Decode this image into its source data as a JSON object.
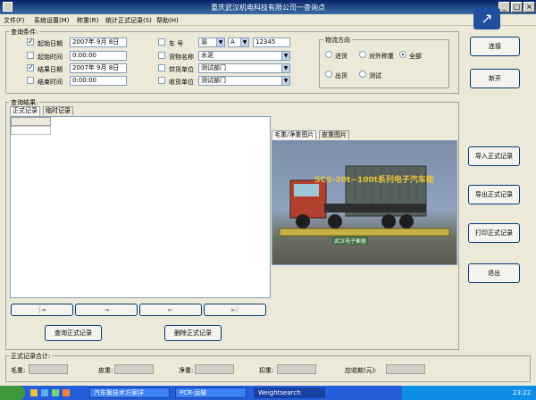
{
  "window": {
    "title": "重庆武汉机电科技有限公司一查询点"
  },
  "menu": [
    "文件(F)",
    "系统设置(M)",
    "称重(R)",
    "统计正式记录(S)",
    "帮助(H)"
  ],
  "query": {
    "group_label": "查询条件:",
    "start_date_label": "起始日期",
    "start_date_value": "2007年 9月 8日",
    "start_time_label": "起始时间",
    "start_time_value": "0:00:00",
    "end_date_label": "结果日期",
    "end_date_value": "2007年 9月 8日",
    "end_time_label": "结束时间",
    "end_time_value": "0:00:00",
    "plate_label": "车  号",
    "plate_province": "渝",
    "plate_letter": "A",
    "plate_number": "12345",
    "goods_label": "货物名称",
    "goods_value": "水泥",
    "supplier_label": "供货单位",
    "supplier_value": "测试部门",
    "receiver_label": "收货单位",
    "receiver_value": "测试部门"
  },
  "direction": {
    "label": "物流方向",
    "in": "进货",
    "external": "对外称重",
    "all": "全部",
    "out": "出货",
    "test": "测试"
  },
  "buttons": {
    "connect": "连接",
    "new": "新开",
    "import": "导入正式记录",
    "export": "导出正式记录",
    "print": "打印正式记录",
    "exit": "退出",
    "query_formal": "查询正式记录",
    "delete_formal": "删除正式记录"
  },
  "results": {
    "group_label": "查询结果:",
    "tab_formal": "正式记录",
    "tab_temp": "临时记录",
    "nav": [
      "|◄",
      "◄",
      "►",
      "►|"
    ]
  },
  "photos": {
    "tab_gross": "毛重/净重图片",
    "tab_tare": "皮重图片",
    "caption": "SCS-20t~100t系列电子汽车衡",
    "scale_label": "武汉电子衡器"
  },
  "summary": {
    "label": "正式记录合计:",
    "gross": "毛重:",
    "tare": "皮重:",
    "net": "净重:",
    "deduct": "扣重:",
    "amount": "应收款(元):"
  },
  "taskbar": {
    "items": [
      "汽车衡技术方案详",
      "PCR-运输",
      "Weightsearch"
    ],
    "clock": "23:22"
  }
}
